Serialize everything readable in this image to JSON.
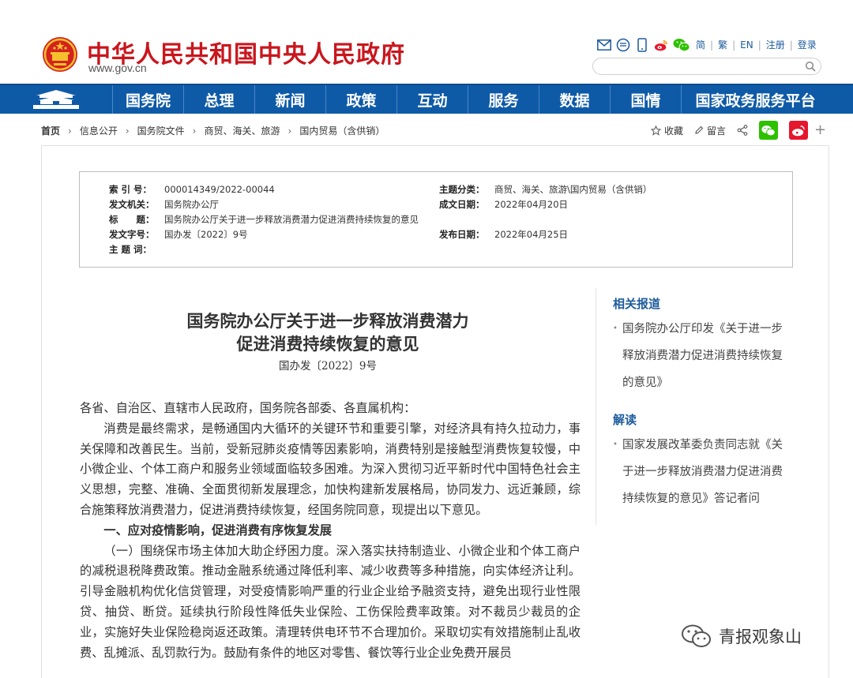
{
  "header": {
    "site_title": "中华人民共和国中央人民政府",
    "site_domain": "www.gov.cn",
    "lang_links": [
      "简",
      "繁",
      "EN",
      "注册",
      "登录"
    ],
    "tool_icons": [
      "mail-icon",
      "message-icon",
      "mobile-icon",
      "weibo-icon",
      "wechat-icon"
    ],
    "search": {
      "placeholder": "",
      "value": ""
    }
  },
  "nav": {
    "items": [
      "国务院",
      "总理",
      "新闻",
      "政策",
      "互动",
      "服务",
      "数据",
      "国情",
      "国家政务服务平台"
    ]
  },
  "breadcrumb": {
    "items": [
      "首页",
      "信息公开",
      "国务院文件",
      "商贸、海关、旅游",
      "国内贸易（含供销）"
    ],
    "favorite": "收藏",
    "comment": "留言"
  },
  "info": {
    "index_label": "索 引 号：",
    "index_value": "000014349/2022-00044",
    "topic_label": "主题分类：",
    "topic_value": "商贸、海关、旅游\\国内贸易（含供销）",
    "issuer_label": "发文机关：",
    "issuer_value": "国务院办公厅",
    "created_label": "成文日期：",
    "created_value": "2022年04月20日",
    "title_label": "标　　题：",
    "title_value": "国务院办公厅关于进一步释放消费潜力促进消费持续恢复的意见",
    "docno_label": "发文字号：",
    "docno_value": "国办发〔2022〕9号",
    "published_label": "发布日期：",
    "published_value": "2022年04月25日",
    "keywords_label": "主 题 词："
  },
  "document": {
    "title_line1": "国务院办公厅关于进一步释放消费潜力",
    "title_line2": "促进消费持续恢复的意见",
    "number": "国办发〔2022〕9号",
    "salutation": "各省、自治区、直辖市人民政府，国务院各部委、各直属机构：",
    "para1": "消费是最终需求，是畅通国内大循环的关键环节和重要引擎，对经济具有持久拉动力，事关保障和改善民生。当前，受新冠肺炎疫情等因素影响，消费特别是接触型消费恢复较慢，中小微企业、个体工商户和服务业领域面临较多困难。为深入贯彻习近平新时代中国特色社会主义思想，完整、准确、全面贯彻新发展理念，加快构建新发展格局，协同发力、远近兼顾，综合施策释放消费潜力，促进消费持续恢复，经国务院同意，现提出以下意见。",
    "heading1": "一、应对疫情影响，促进消费有序恢复发展",
    "para2": "（一）围绕保市场主体加大助企纾困力度。深入落实扶持制造业、小微企业和个体工商户的减税退税降费政策。推动金融系统通过降低利率、减少收费等多种措施，向实体经济让利。引导金融机构优化信贷管理，对受疫情影响严重的行业企业给予融资支持，避免出现行业性限贷、抽贷、断贷。延续执行阶段性降低失业保险、工伤保险费率政策。对不裁员少裁员的企业，实施好失业保险稳岗返还政策。清理转供电环节不合理加价。采取切实有效措施制止乱收费、乱摊派、乱罚款行为。鼓励有条件的地区对零售、餐饮等行业企业免费开展员"
  },
  "sidebar": {
    "related_heading": "相关报道",
    "related_link": "国务院办公厅印发《关于进一步释放消费潜力促进消费持续恢复的意见》",
    "interpret_heading": "解读",
    "interpret_link": "国家发展改革委负责同志就《关于进一步释放消费潜力促进消费持续恢复的意见》答记者问"
  },
  "watermark": "青报观象山",
  "colors": {
    "brand_red": "#c9161d",
    "nav_blue": "#0e5aa7",
    "link_blue": "#1d5b9c",
    "wechat_green": "#2dc100",
    "weibo_red": "#e6162d"
  }
}
